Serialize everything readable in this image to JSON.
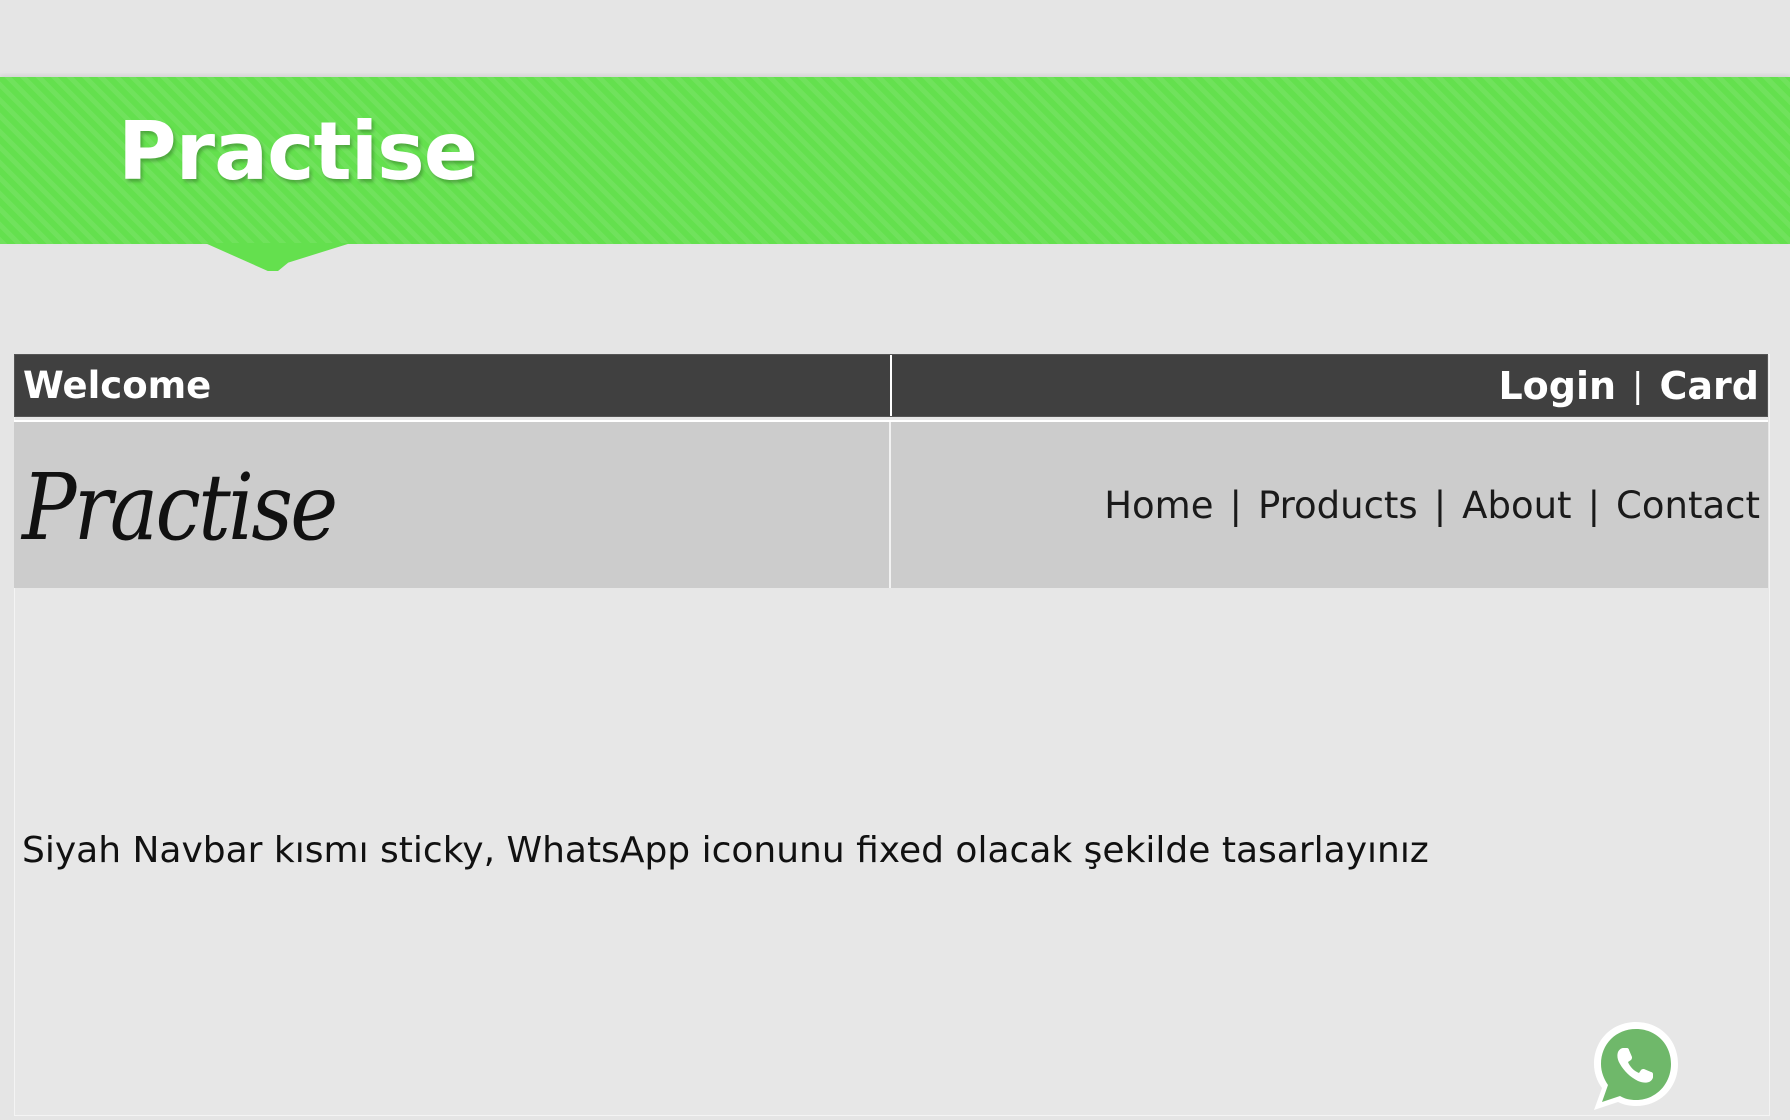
{
  "banner": {
    "title": "Practise"
  },
  "topbar": {
    "welcome": "Welcome",
    "login_label": "Login",
    "separator": "|",
    "card_label": "Card"
  },
  "header": {
    "logo_text": "Practise",
    "nav": [
      {
        "label": "Home"
      },
      {
        "label": "Products"
      },
      {
        "label": "About"
      },
      {
        "label": "Contact"
      }
    ],
    "separator": "|"
  },
  "content": {
    "text": "Siyah Navbar kısmı sticky, WhatsApp iconunu fixed olacak şekilde tasarlayınız"
  },
  "icons": {
    "whatsapp": "whatsapp-icon"
  },
  "colors": {
    "banner_green": "#64e04e",
    "topbar_dark": "#404040",
    "header_gray": "#cccccc",
    "whatsapp_green": "#6fb86a"
  }
}
